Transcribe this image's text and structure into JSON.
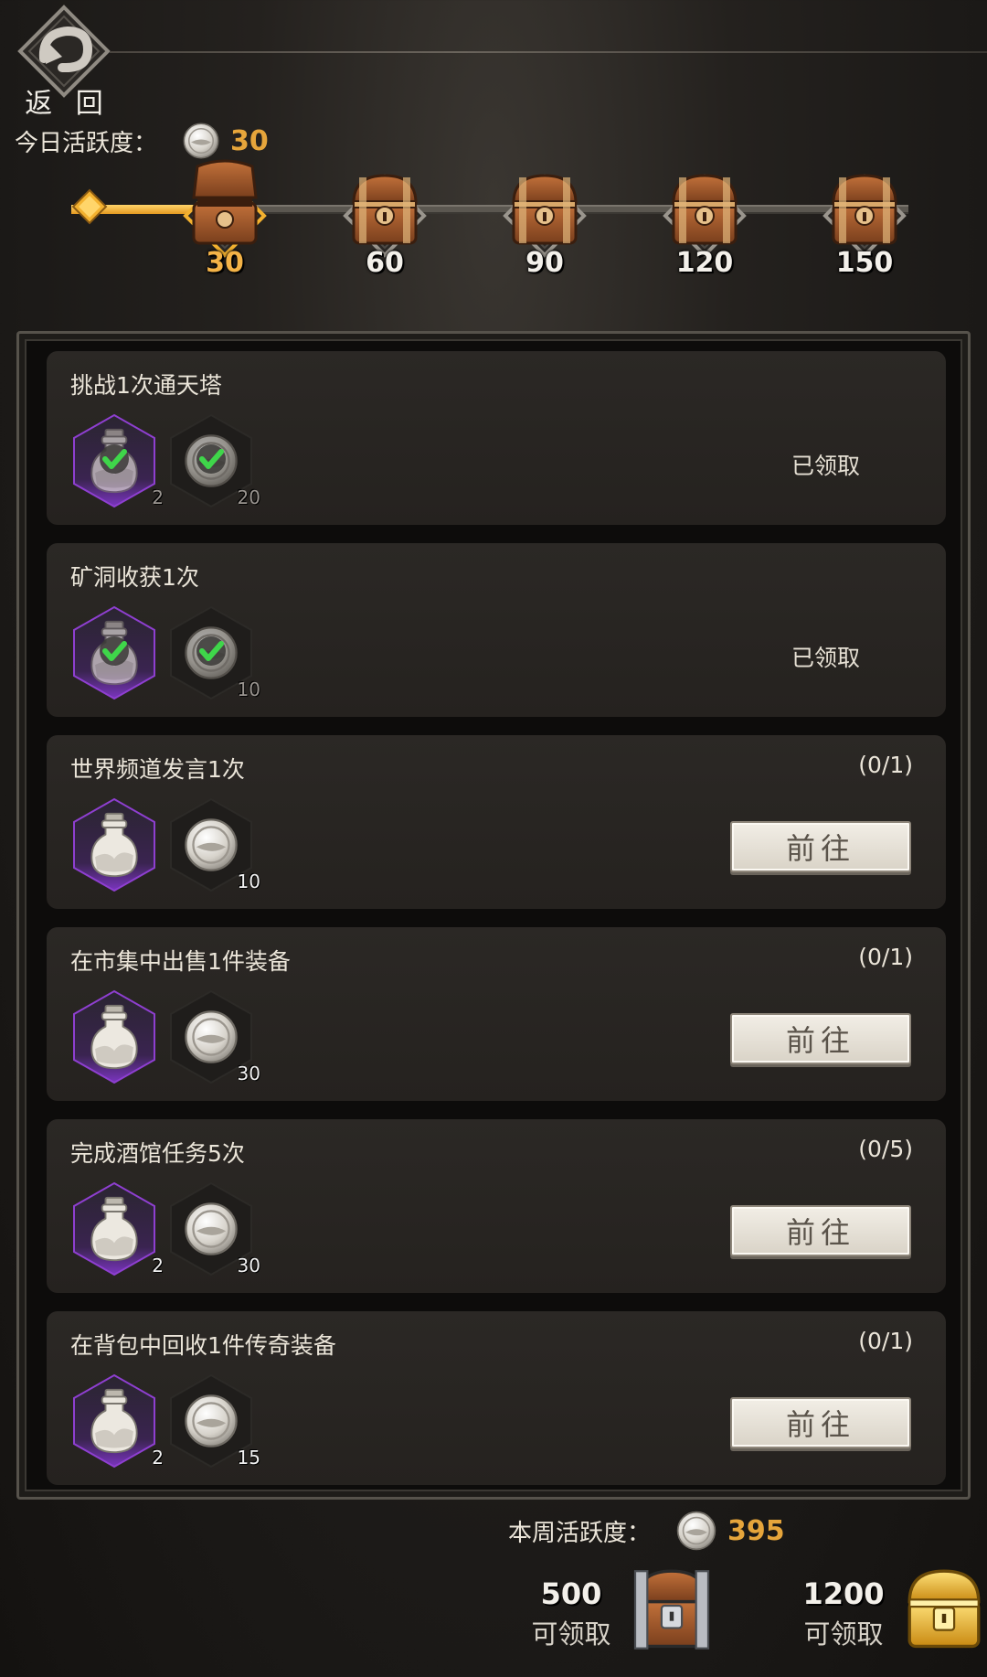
{
  "header": {
    "back_label": "返 回",
    "daily_activity_label": "今日活跃度：",
    "daily_activity_value": "30"
  },
  "milestones": [
    {
      "value": "30",
      "state": "opened"
    },
    {
      "value": "60",
      "state": "locked"
    },
    {
      "value": "90",
      "state": "locked"
    },
    {
      "value": "120",
      "state": "locked"
    },
    {
      "value": "150",
      "state": "locked"
    }
  ],
  "progress_fraction": 0.2,
  "tasks": [
    {
      "title": "挑战1次通天塔",
      "progress": "",
      "rewards": [
        {
          "icon": "potion-bottle-icon",
          "qty": "2"
        },
        {
          "icon": "activity-coin-icon",
          "qty": "20"
        }
      ],
      "status": "已领取",
      "action": ""
    },
    {
      "title": "矿洞收获1次",
      "progress": "",
      "rewards": [
        {
          "icon": "potion-bottle-icon",
          "qty": ""
        },
        {
          "icon": "activity-coin-icon",
          "qty": "10"
        }
      ],
      "status": "已领取",
      "action": ""
    },
    {
      "title": "世界频道发言1次",
      "progress": "(0/1)",
      "rewards": [
        {
          "icon": "potion-bottle-icon",
          "qty": ""
        },
        {
          "icon": "activity-coin-icon",
          "qty": "10"
        }
      ],
      "status": "",
      "action": "前往"
    },
    {
      "title": "在市集中出售1件装备",
      "progress": "(0/1)",
      "rewards": [
        {
          "icon": "potion-bottle-icon",
          "qty": ""
        },
        {
          "icon": "activity-coin-icon",
          "qty": "30"
        }
      ],
      "status": "",
      "action": "前往"
    },
    {
      "title": "完成酒馆任务5次",
      "progress": "(0/5)",
      "rewards": [
        {
          "icon": "potion-bottle-icon",
          "qty": "2"
        },
        {
          "icon": "activity-coin-icon",
          "qty": "30"
        }
      ],
      "status": "",
      "action": "前往"
    },
    {
      "title": "在背包中回收1件传奇装备",
      "progress": "(0/1)",
      "rewards": [
        {
          "icon": "potion-bottle-icon",
          "qty": "2"
        },
        {
          "icon": "activity-coin-icon",
          "qty": "15"
        }
      ],
      "status": "",
      "action": "前往"
    }
  ],
  "footer": {
    "weekly_activity_label": "本周活跃度：",
    "weekly_activity_value": "395",
    "weekly_rewards": [
      {
        "value": "500",
        "status": "可领取",
        "chest": "silver-chest-icon"
      },
      {
        "value": "1200",
        "status": "可领取",
        "chest": "gold-chest-icon"
      }
    ]
  },
  "colors": {
    "accent_gold": "#e6a53b",
    "claimed_check": "#3fd64a",
    "reward_frame_purple": "#8e3fd0"
  }
}
